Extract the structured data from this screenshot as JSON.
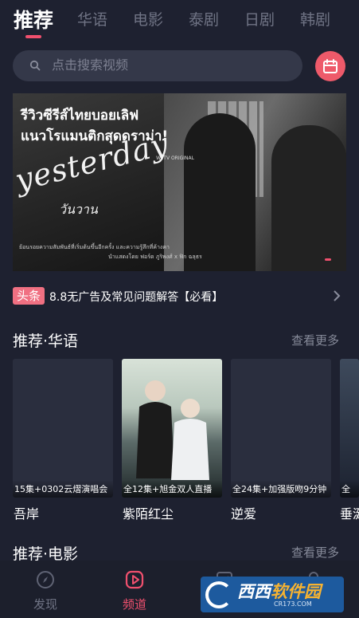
{
  "top_tabs": [
    {
      "label": "推荐",
      "active": true
    },
    {
      "label": "华语",
      "active": false
    },
    {
      "label": "电影",
      "active": false
    },
    {
      "label": "泰剧",
      "active": false
    },
    {
      "label": "日剧",
      "active": false
    },
    {
      "label": "韩剧",
      "active": false
    }
  ],
  "search": {
    "placeholder": "点击搜索视频",
    "icon": "search-icon"
  },
  "calendar_button": {
    "icon": "calendar-icon"
  },
  "banner": {
    "headline_line1": "รีวิวซีรีส์ไทยบอยเลิฟ",
    "headline_line2": "แนวโรแมนติกสุดดราม่า!",
    "brand": "WeTV ORIGINAL",
    "title": "yesterday",
    "subtitle": "วันวาน",
    "description": "ย้อนรอยความสัมพันธ์ที่เริ่มต้นขึ้นอีกครั้ง และความรู้สึกที่ค้างคา",
    "credit": "นำแสดงโดย ฟอร์ด ภูริพงศ์ x ฟิก ฉลุธร"
  },
  "news": {
    "badge": "头条",
    "text": "8.8无广告及常见问题解答【必看】"
  },
  "sections": [
    {
      "title": "推荐·华语",
      "more": "查看更多"
    },
    {
      "title": "推荐·电影",
      "more": "查看更多"
    }
  ],
  "cards": [
    {
      "tag": "15集+0302云熠演唱会",
      "name": "吾岸"
    },
    {
      "tag": "全12集+旭金双人直播",
      "name": "紫陌红尘"
    },
    {
      "tag": "全24集+加强版吻9分钟",
      "name": "逆爱"
    },
    {
      "tag": "全",
      "name": "垂涎"
    }
  ],
  "bottom_nav": [
    {
      "label": "发现",
      "icon": "compass-icon",
      "active": false
    },
    {
      "label": "频道",
      "icon": "play-icon",
      "active": true
    },
    {
      "label": "",
      "icon": "checkbox-icon",
      "active": false
    },
    {
      "label": "",
      "icon": "person-icon",
      "active": false
    }
  ],
  "watermark": {
    "text_part1": "西西",
    "text_part2": "软件园",
    "url": "CR173.COM"
  },
  "colors": {
    "background": "#1e2130",
    "accent": "#f0506e",
    "inactive_text": "#6f7384"
  }
}
